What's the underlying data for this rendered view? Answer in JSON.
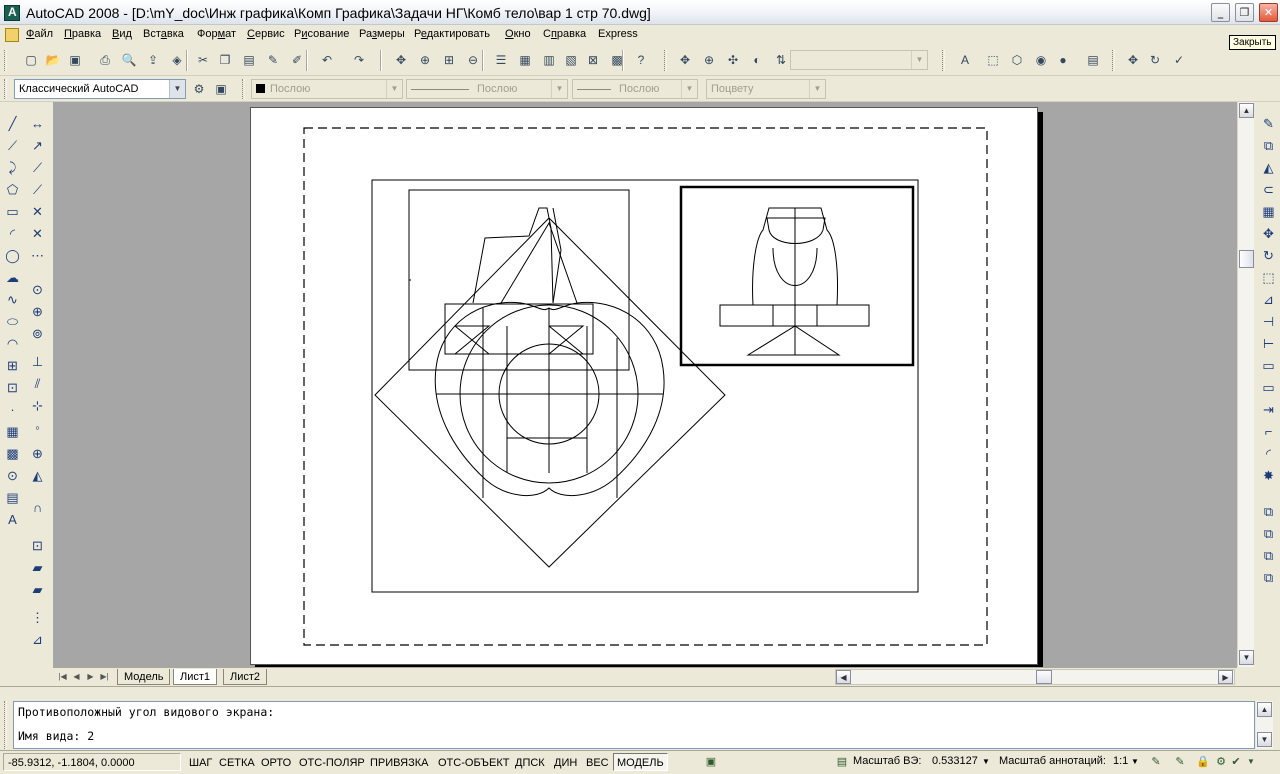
{
  "window": {
    "title": "AutoCAD 2008 - [D:\\mY_doc\\Инж графика\\Комп Графика\\Задачи НГ\\Комб тело\\вар 1 стр 70.dwg]",
    "tooltip": "Закрыть"
  },
  "menu": {
    "items": [
      {
        "acc": "Ф",
        "rest": "айл"
      },
      {
        "acc": "П",
        "rest": "равка"
      },
      {
        "acc": "В",
        "rest": "ид"
      },
      {
        "acc": "",
        "rest": "Вст",
        "acc2": "а",
        "rest2": "вка"
      },
      {
        "acc": "",
        "rest": "Фор",
        "acc2": "м",
        "rest2": "ат"
      },
      {
        "acc": "С",
        "rest": "ервис"
      },
      {
        "acc": "",
        "rest": "Р",
        "acc2": "и",
        "rest2": "сование"
      },
      {
        "acc": "",
        "rest": "Ра",
        "acc2": "з",
        "rest2": "меры"
      },
      {
        "acc": "",
        "rest": "Р",
        "acc2": "е",
        "rest2": "дактировать"
      },
      {
        "acc": "О",
        "rest": "кно"
      },
      {
        "acc": "",
        "rest": "С",
        "acc2": "п",
        "rest2": "равка"
      },
      {
        "acc": "",
        "rest": "Express"
      }
    ]
  },
  "toolbar2": {
    "workspace": "Классический AutoCAD",
    "layer_color": "Послою",
    "linetype": "Послою",
    "lineweight": "Послою",
    "plotstyle": "Поцвету"
  },
  "tabs": {
    "items": [
      "Модель",
      "Лист1",
      "Лист2"
    ],
    "active": "Лист1"
  },
  "command": {
    "line1": "Противоположный угол видового экрана:",
    "line2": "Имя вида: 2"
  },
  "status": {
    "coords": "-85.9312, -1.1804, 0.0000",
    "modes": [
      {
        "label": "ШАГ",
        "on": false
      },
      {
        "label": "СЕТКА",
        "on": false
      },
      {
        "label": "ОРТО",
        "on": false
      },
      {
        "label": "ОТС-ПОЛЯР",
        "on": false
      },
      {
        "label": "ПРИВЯЗКА",
        "on": false
      },
      {
        "label": "ОТС-ОБЪЕКТ",
        "on": false
      },
      {
        "label": "ДПСК",
        "on": false
      },
      {
        "label": "ДИН",
        "on": false
      },
      {
        "label": "ВЕС",
        "on": false
      },
      {
        "label": "МОДЕЛЬ",
        "on": true
      }
    ],
    "viewport_scale_label": "Масштаб ВЭ:",
    "viewport_scale_value": "0.533127",
    "annotation_scale_label": "Масштаб аннотаций:",
    "annotation_scale_value": "1:1"
  },
  "colors": {
    "background": "#a6a6a6",
    "paper": "#ffffff",
    "chrome": "#ece9d8",
    "accent": "#7f9db9"
  }
}
